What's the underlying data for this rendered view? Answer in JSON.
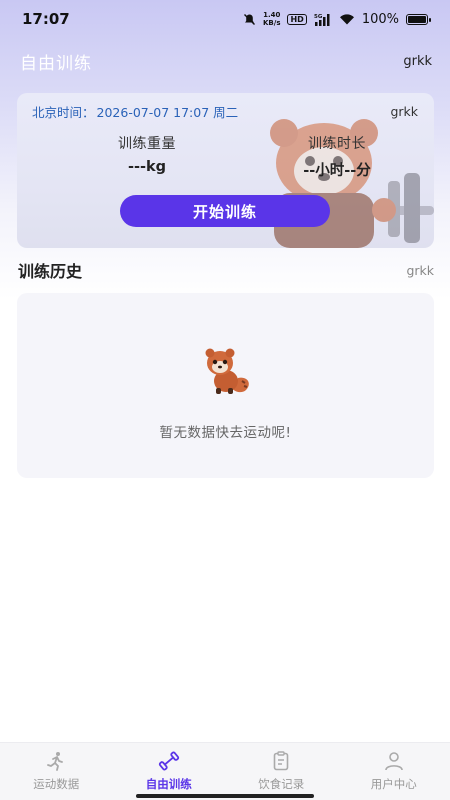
{
  "status_bar": {
    "time": "17:07",
    "net_speed_top": "1.40",
    "net_speed_bottom": "KB/s",
    "hd_badge": "HD",
    "signal_label": "5G",
    "battery": "100%"
  },
  "header": {
    "title": "自由训练",
    "user": "grkk"
  },
  "training_card": {
    "time_label": "北京时间：",
    "time_value": "2026-07-07 17:07 周二",
    "user": "grkk",
    "weight_label": "训练重量",
    "weight_value": "---kg",
    "duration_label": "训练时长",
    "duration_value": "--小时--分",
    "start_button": "开始训练"
  },
  "history": {
    "title": "训练历史",
    "user": "grkk",
    "empty_text": "暂无数据快去运动呢!"
  },
  "bottom_nav": {
    "items": [
      {
        "label": "运动数据",
        "icon": "running-icon"
      },
      {
        "label": "自由训练",
        "icon": "dumbbell-icon"
      },
      {
        "label": "饮食记录",
        "icon": "clipboard-icon"
      },
      {
        "label": "用户中心",
        "icon": "user-icon"
      }
    ],
    "active_index": 1
  },
  "colors": {
    "accent": "#5a35e8",
    "time_text": "#2a62b8"
  }
}
